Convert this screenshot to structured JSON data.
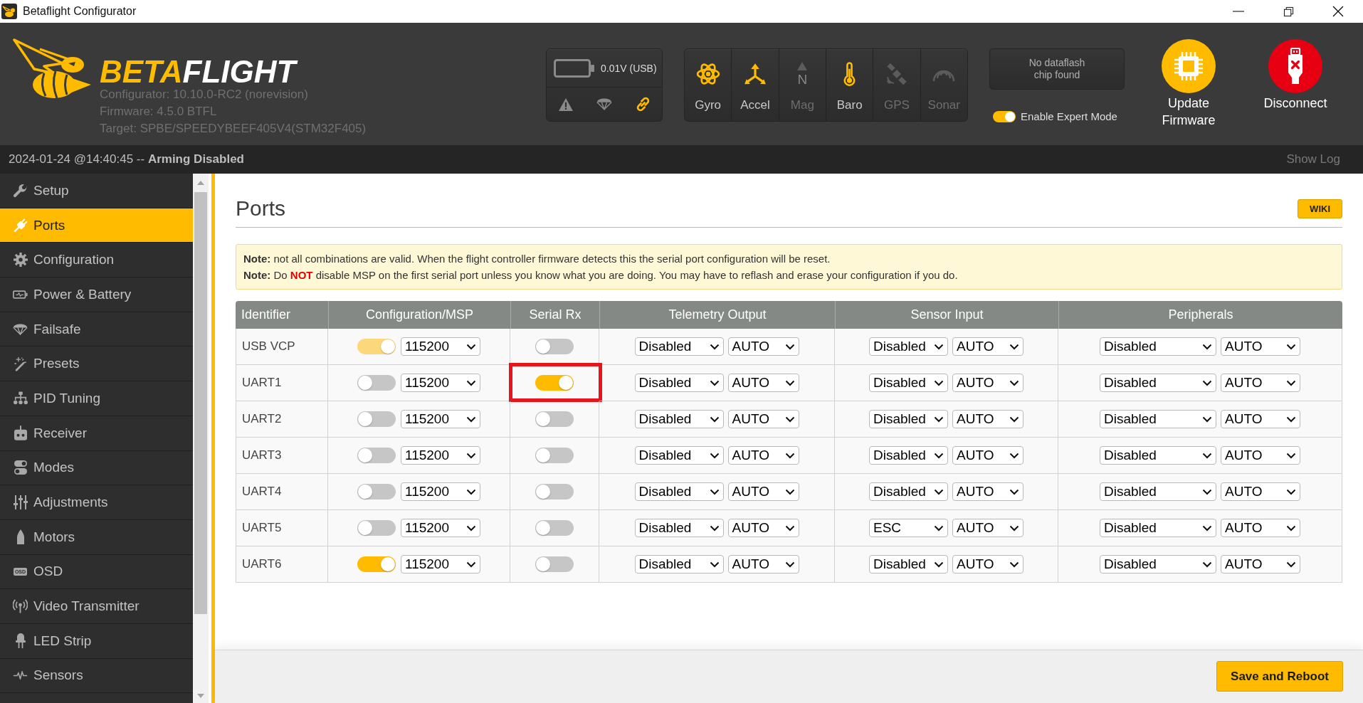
{
  "window": {
    "title": "Betaflight Configurator"
  },
  "header": {
    "logo": {
      "wordmark": [
        {
          "text": "BETA",
          "accent": true
        },
        {
          "text": "FLIGHT",
          "accent": false
        }
      ]
    },
    "versions": [
      "Configurator: 10.10.0-RC2 (norevision)",
      "Firmware: 4.5.0 BTFL",
      "Target: SPBE/SPEEDYBEEF405V4(STM32F405)"
    ],
    "battery": {
      "reading": "0.01V (USB)",
      "indicators": [
        {
          "active": false
        },
        {
          "active": false
        },
        {
          "active": true
        }
      ]
    },
    "sensors": [
      {
        "label": "Gyro",
        "active": true
      },
      {
        "label": "Accel",
        "active": true
      },
      {
        "label": "Mag",
        "active": false,
        "symbol": "N"
      },
      {
        "label": "Baro",
        "active": true
      },
      {
        "label": "GPS",
        "active": false
      },
      {
        "label": "Sonar",
        "active": false
      }
    ],
    "dataflash": {
      "message": "No dataflash chip found"
    },
    "expert_mode": {
      "label": "Enable Expert Mode",
      "on": true
    },
    "buttons": [
      {
        "label": "Update Firmware",
        "kind": "update"
      },
      {
        "label": "Disconnect",
        "kind": "disconnect"
      }
    ]
  },
  "status_bar": {
    "text": "2024-01-24 @14:40:45 -- **Arming Disabled**",
    "show_log": "Show Log"
  },
  "sidebar": {
    "items": [
      {
        "label": "Setup",
        "selected": false
      },
      {
        "label": "Ports",
        "selected": true
      },
      {
        "label": "Configuration",
        "selected": false
      },
      {
        "label": "Power & Battery",
        "selected": false
      },
      {
        "label": "Failsafe",
        "selected": false
      },
      {
        "label": "Presets",
        "selected": false
      },
      {
        "label": "PID Tuning",
        "selected": false
      },
      {
        "label": "Receiver",
        "selected": false
      },
      {
        "label": "Modes",
        "selected": false
      },
      {
        "label": "Adjustments",
        "selected": false
      },
      {
        "label": "Motors",
        "selected": false
      },
      {
        "label": "OSD",
        "selected": false,
        "icon_text": "OSD"
      },
      {
        "label": "Video Transmitter",
        "selected": false
      },
      {
        "label": "LED Strip",
        "selected": false
      },
      {
        "label": "Sensors",
        "selected": false
      }
    ]
  },
  "page": {
    "title": "Ports",
    "wiki": "WIKI",
    "notes": [
      "**Note:** not all combinations are valid. When the flight controller firmware detects this the serial port configuration will be reset.",
      "**Note:** Do **NOT** disable MSP on the first serial port unless you know what you are doing. You may have to reflash and erase your configuration if you do."
    ],
    "table": {
      "columns": [
        "Identifier",
        "Configuration/MSP",
        "Serial Rx",
        "Telemetry Output",
        "Sensor Input",
        "Peripherals"
      ],
      "rows": [
        {
          "identifier": "USB VCP",
          "msp": {
            "on": true,
            "disabled": true
          },
          "baud": "115200",
          "serial_rx": {
            "on": false,
            "highlighted": false
          },
          "telemetry": {
            "value": "Disabled",
            "baud": "AUTO"
          },
          "sensor": {
            "value": "Disabled",
            "baud": "AUTO"
          },
          "peripherals": {
            "value": "Disabled",
            "baud": "AUTO"
          }
        },
        {
          "identifier": "UART1",
          "msp": {
            "on": false,
            "disabled": false
          },
          "baud": "115200",
          "serial_rx": {
            "on": true,
            "highlighted": true
          },
          "telemetry": {
            "value": "Disabled",
            "baud": "AUTO"
          },
          "sensor": {
            "value": "Disabled",
            "baud": "AUTO"
          },
          "peripherals": {
            "value": "Disabled",
            "baud": "AUTO"
          }
        },
        {
          "identifier": "UART2",
          "msp": {
            "on": false,
            "disabled": false
          },
          "baud": "115200",
          "serial_rx": {
            "on": false,
            "highlighted": false
          },
          "telemetry": {
            "value": "Disabled",
            "baud": "AUTO"
          },
          "sensor": {
            "value": "Disabled",
            "baud": "AUTO"
          },
          "peripherals": {
            "value": "Disabled",
            "baud": "AUTO"
          }
        },
        {
          "identifier": "UART3",
          "msp": {
            "on": false,
            "disabled": false
          },
          "baud": "115200",
          "serial_rx": {
            "on": false,
            "highlighted": false
          },
          "telemetry": {
            "value": "Disabled",
            "baud": "AUTO"
          },
          "sensor": {
            "value": "Disabled",
            "baud": "AUTO"
          },
          "peripherals": {
            "value": "Disabled",
            "baud": "AUTO"
          }
        },
        {
          "identifier": "UART4",
          "msp": {
            "on": false,
            "disabled": false
          },
          "baud": "115200",
          "serial_rx": {
            "on": false,
            "highlighted": false
          },
          "telemetry": {
            "value": "Disabled",
            "baud": "AUTO"
          },
          "sensor": {
            "value": "Disabled",
            "baud": "AUTO"
          },
          "peripherals": {
            "value": "Disabled",
            "baud": "AUTO"
          }
        },
        {
          "identifier": "UART5",
          "msp": {
            "on": false,
            "disabled": false
          },
          "baud": "115200",
          "serial_rx": {
            "on": false,
            "highlighted": false
          },
          "telemetry": {
            "value": "Disabled",
            "baud": "AUTO"
          },
          "sensor": {
            "value": "ESC",
            "baud": "AUTO"
          },
          "peripherals": {
            "value": "Disabled",
            "baud": "AUTO"
          }
        },
        {
          "identifier": "UART6",
          "msp": {
            "on": true,
            "disabled": false
          },
          "baud": "115200",
          "serial_rx": {
            "on": false,
            "highlighted": false
          },
          "telemetry": {
            "value": "Disabled",
            "baud": "AUTO"
          },
          "sensor": {
            "value": "Disabled",
            "baud": "AUTO"
          },
          "peripherals": {
            "value": "Disabled",
            "baud": "AUTO"
          }
        }
      ]
    }
  },
  "footer": {
    "button": "Save and Reboot"
  }
}
